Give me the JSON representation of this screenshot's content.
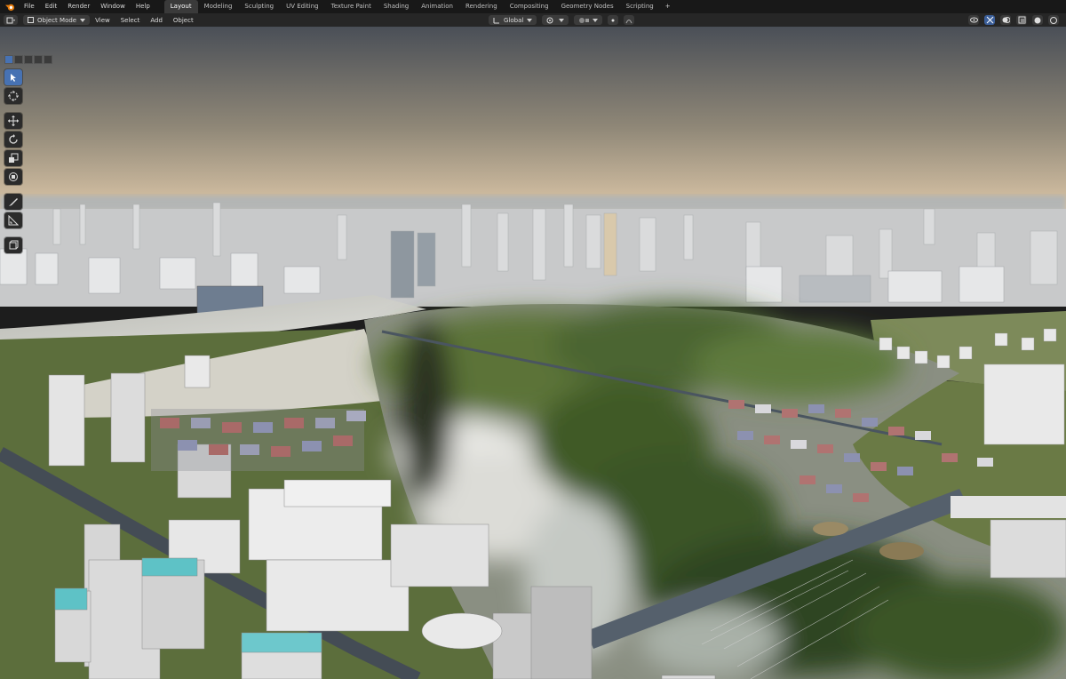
{
  "app": {
    "menu": [
      "File",
      "Edit",
      "Render",
      "Window",
      "Help"
    ],
    "workspaces": [
      "Layout",
      "Modeling",
      "Sculpting",
      "UV Editing",
      "Texture Paint",
      "Shading",
      "Animation",
      "Rendering",
      "Compositing",
      "Geometry Nodes",
      "Scripting"
    ],
    "active_workspace": "Layout",
    "add_tab_label": "+"
  },
  "header": {
    "mode": "Object Mode",
    "menus": [
      "View",
      "Select",
      "Add",
      "Object"
    ],
    "transform_orientation": "Global"
  },
  "icons": {
    "editor_type": "viewport-icon",
    "tools": [
      "select-box-icon",
      "cursor-icon",
      "move-icon",
      "rotate-icon",
      "scale-icon",
      "transform-icon",
      "annotate-icon",
      "measure-icon",
      "add-cube-icon"
    ],
    "right": [
      "visibility-icon",
      "gizmo-icon",
      "overlay-icon",
      "xray-icon"
    ]
  },
  "colors": {
    "accent": "#4772b3",
    "topbar": "#181818",
    "header": "#262626",
    "sky_top": "#4a4f57",
    "sky_horizon": "#d9c4a6",
    "water": "#c9c6bb",
    "foliage": "#4c6b33"
  }
}
